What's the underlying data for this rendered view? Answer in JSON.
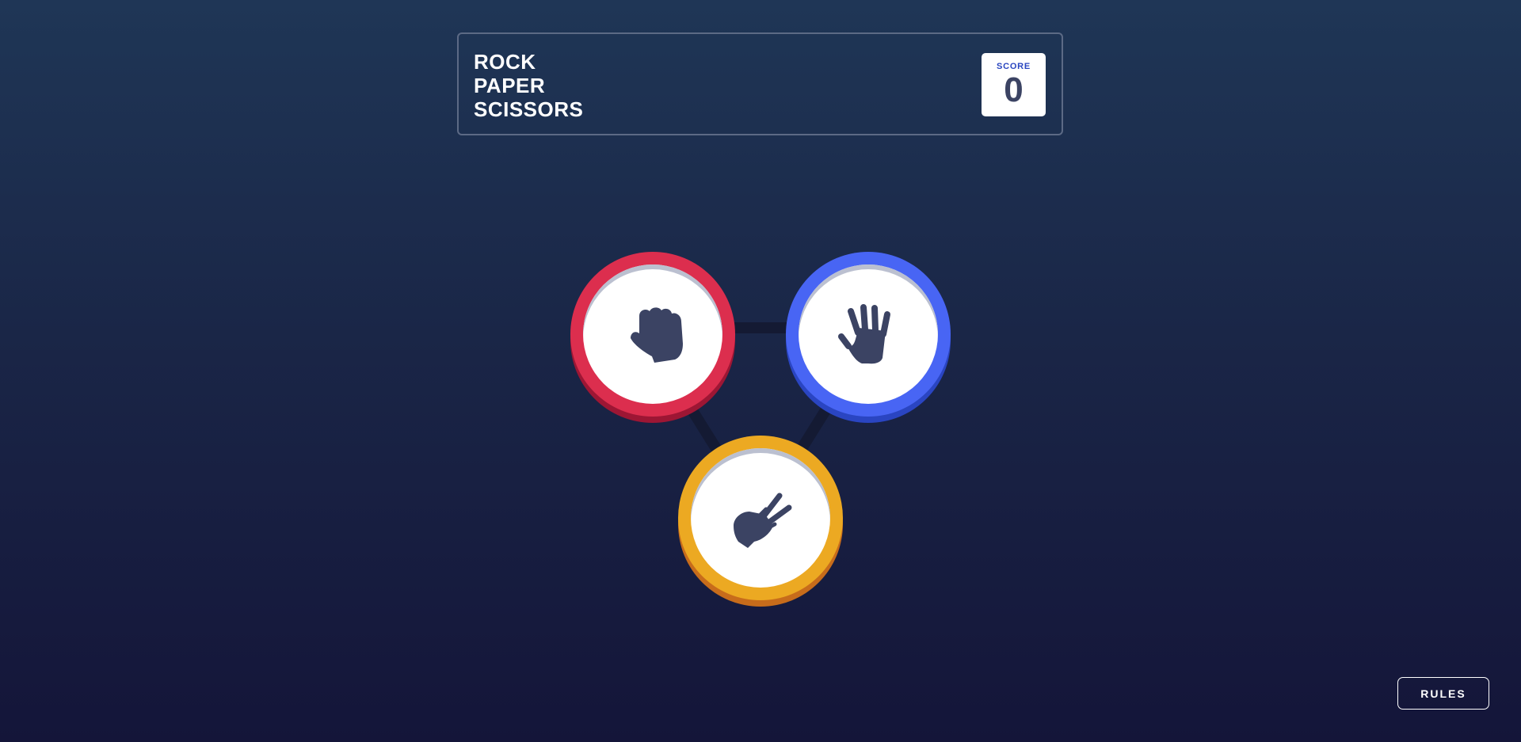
{
  "header": {
    "title_lines": [
      "ROCK",
      "PAPER",
      "SCISSORS"
    ]
  },
  "score": {
    "label": "SCORE",
    "value": "0"
  },
  "choices": [
    {
      "name": "rock",
      "icon": "fist-icon",
      "ring_color": "#dc2e4e"
    },
    {
      "name": "paper",
      "icon": "open-hand-icon",
      "ring_color": "#4865f4"
    },
    {
      "name": "scissors",
      "icon": "scissors-hand-icon",
      "ring_color": "#eca922"
    }
  ],
  "rules_button": {
    "label": "RULES"
  }
}
